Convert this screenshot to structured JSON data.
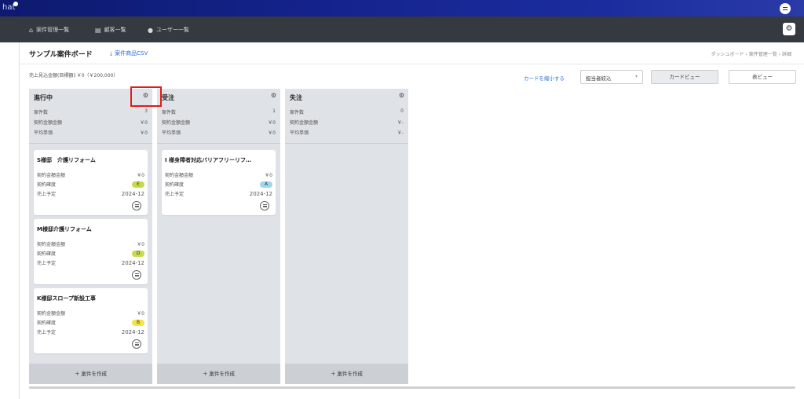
{
  "topbar": {
    "logo_text": "hat",
    "user_icon": "menu-circle-icon"
  },
  "nav": {
    "items": [
      {
        "label": "案件管理一覧",
        "icon": "home-icon",
        "glyph": "⌂"
      },
      {
        "label": "顧客一覧",
        "icon": "document-icon",
        "glyph": "▤"
      },
      {
        "label": "ユーザー一覧",
        "icon": "user-icon",
        "glyph": "●"
      }
    ],
    "settings_icon": "gear-icon"
  },
  "header": {
    "title": "サンプル案件ボード",
    "csv_label": "案件商品CSV",
    "breadcrumb": [
      "ダッシュボード",
      "案件管理一覧",
      "詳細"
    ]
  },
  "summary": {
    "text": "売上見込金額(目標額):￥0（￥200,000）"
  },
  "toolbar": {
    "shrink_label": "カードを縮小する",
    "filter_select": "担当者絞込",
    "card_view": "カードビュー",
    "table_view": "表ビュー"
  },
  "columns": [
    {
      "title": "進行中",
      "stats": [
        {
          "label": "案件数",
          "value": "3"
        },
        {
          "label": "契約金額金額",
          "value": "￥0"
        },
        {
          "label": "平均単価",
          "value": "￥0"
        }
      ],
      "cards": [
        {
          "title": "S様邸　介護リフォーム",
          "amount": "￥0",
          "certainty": "E",
          "certainty_color": "#c8d94a",
          "date": "2024-12"
        },
        {
          "title": "M様邸介護リフォーム",
          "amount": "￥0",
          "certainty": "D",
          "certainty_color": "#c8d94a",
          "date": "2024-12"
        },
        {
          "title": "K様邸スロープ新設工事",
          "amount": "￥0",
          "certainty": "B",
          "certainty_color": "#f3e34a",
          "date": "2024-12"
        }
      ],
      "create_label": "案件を作成"
    },
    {
      "title": "受注",
      "stats": [
        {
          "label": "案件数",
          "value": "1"
        },
        {
          "label": "契約金額金額",
          "value": "￥0"
        },
        {
          "label": "平均単価",
          "value": "￥0"
        }
      ],
      "cards": [
        {
          "title": "I 様身障者対応バリアフリーリフ…",
          "amount": "￥0",
          "certainty": "A",
          "certainty_color": "#9fd6ef",
          "date": "2024-12"
        }
      ],
      "create_label": "案件を作成"
    },
    {
      "title": "失注",
      "stats": [
        {
          "label": "案件数",
          "value": "0"
        },
        {
          "label": "契約金額金額",
          "value": "￥-"
        },
        {
          "label": "平均単価",
          "value": "￥-"
        }
      ],
      "cards": [],
      "create_label": "案件を作成"
    }
  ],
  "card_labels": {
    "amount": "契約金額金額",
    "certainty": "契約確度",
    "date": "売上予定"
  }
}
